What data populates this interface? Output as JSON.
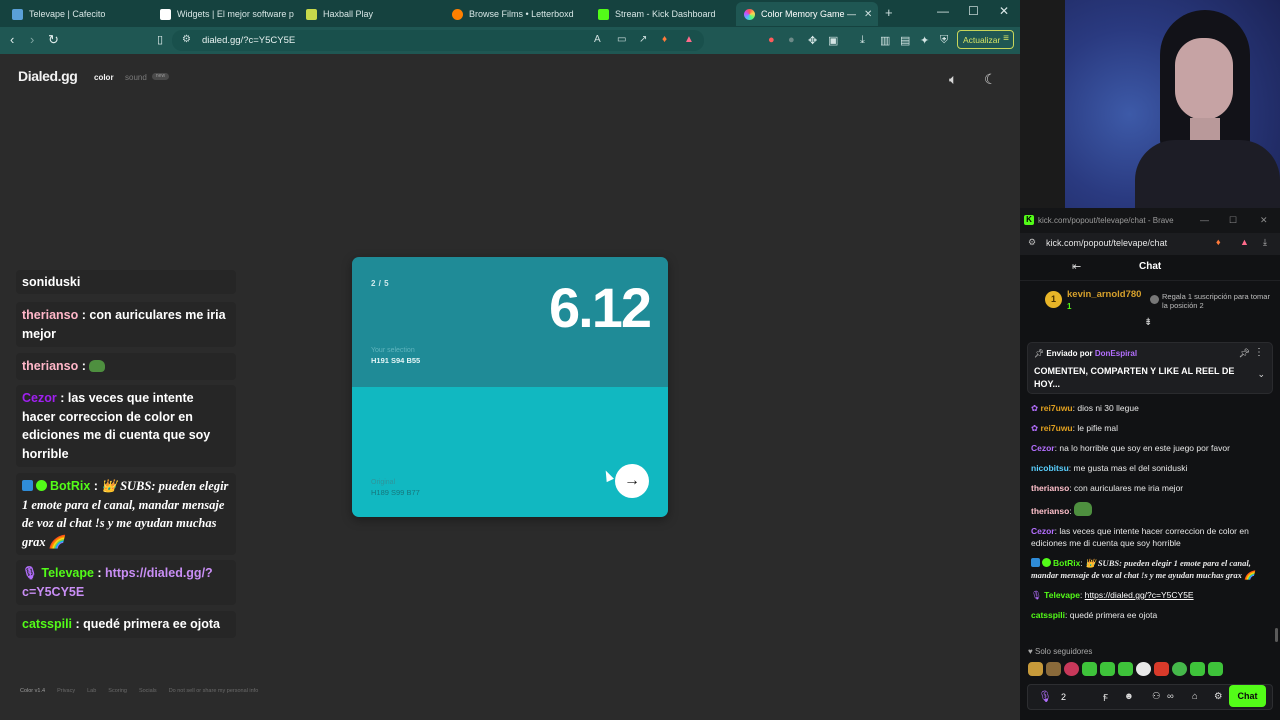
{
  "browser": {
    "tabs": [
      {
        "label": "Televape | Cafecito",
        "color": "#5aa0d8"
      },
      {
        "label": "Widgets | El mejor software para",
        "color": "#ffffff"
      },
      {
        "label": "Haxball Play",
        "color": "#c7d94b"
      },
      {
        "label": "Browse Films • Letterboxd",
        "color": "#ff8000"
      },
      {
        "label": "Stream - Kick Dashboard",
        "color": "#53fc18"
      },
      {
        "label": "Color Memory Game —",
        "color": "#ff4fa0",
        "active": true
      }
    ],
    "new_tab": "+",
    "url": "dialed.gg/?c=Y5CY5E",
    "update_label": "Actualizar"
  },
  "site": {
    "brand": "Dialed.gg",
    "nav_color": "color",
    "nav_sound": "sound",
    "nav_badge": "new",
    "card": {
      "round": "2 / 5",
      "score": "6.12",
      "selection_label": "Your selection",
      "selection_value": "H191 S94 B55",
      "original_label": "Original",
      "original_value": "H189 S99 B77",
      "selection_color": "#1f8b97",
      "original_color": "#11b8c1"
    },
    "footer": [
      "Color v1.4",
      "Privacy",
      "Lab",
      "Scoring",
      "Socials",
      "Do not sell or share my personal info"
    ]
  },
  "overlay": [
    {
      "user": "",
      "text": "soniduski"
    },
    {
      "user": "therianso",
      "sep": " : ",
      "text": "con auriculares me iria mejor",
      "color": "#ffb6c8"
    },
    {
      "user": "therianso",
      "sep": " : ",
      "text": "",
      "color": "#ffb6c8"
    },
    {
      "user": "Cezor",
      "sep": " : ",
      "text": "las veces que intente hacer correccion de color en ediciones me di cuenta que soy horrible",
      "color": "#a020f0"
    },
    {
      "user": "BotRix",
      "sep": " : ",
      "text": "👑 SUBS: pueden elegir 1 emote para el canal, mandar mensaje de voz al chat !s y me ayudan muchas grax 🌈",
      "color": "#53fc18"
    },
    {
      "user": "Televape",
      "sep": " : ",
      "text": "https://dialed.gg/?c=Y5CY5E",
      "color": "#53fc18"
    },
    {
      "user": "catsspili",
      "sep": " : ",
      "text": "quedé primera ee ojota",
      "color": "#53fc18"
    }
  ],
  "chat": {
    "window_title": "kick.com/popout/televape/chat - Brave",
    "url": "kick.com/popout/televape/chat",
    "header": "Chat",
    "gifter": {
      "name": "kevin_arnold780",
      "count": "1",
      "cta": "Regala 1 suscripción para tomar la posición 2"
    },
    "pinned": {
      "by_label": "Enviado por",
      "by_user": "DonEspiral",
      "text": "COMENTEN, COMPARTEN Y LIKE AL REEL DE HOY..."
    },
    "messages": [
      {
        "user": "rei7uwu",
        "text": "dios ni 30 llegue",
        "color": "#e0a020"
      },
      {
        "user": "rei7uwu",
        "text": "le pifie mal",
        "color": "#e0a020"
      },
      {
        "user": "Cezor",
        "text": "na lo horrible que soy en este juego por favor",
        "color": "#b46fff"
      },
      {
        "user": "nicobitsu",
        "text": "me gusta mas el del soniduski",
        "color": "#5ad0ff"
      },
      {
        "user": "therianso",
        "text": "con auriculares me iria mejor",
        "color": "#ffc0cb"
      },
      {
        "user": "therianso",
        "text": "",
        "color": "#ffc0cb"
      },
      {
        "user": "Cezor",
        "text": "las veces que intente hacer correccion de color en ediciones me di cuenta que soy horrible",
        "color": "#b46fff"
      },
      {
        "user": "BotRix",
        "text": "👑 SUBS: pueden elegir 1 emote para el canal, mandar mensaje de voz al chat !s y me ayudan muchas grax 🌈",
        "color": "#53fc18"
      },
      {
        "user": "Televape",
        "text": "https://dialed.gg/?c=Y5CY5E",
        "color": "#53fc18"
      },
      {
        "user": "catsspili",
        "text": "quedé primera ee ojota",
        "color": "#53fc18"
      }
    ],
    "followers_only": "Solo seguidores",
    "input_value": "2",
    "send_label": "Chat"
  }
}
